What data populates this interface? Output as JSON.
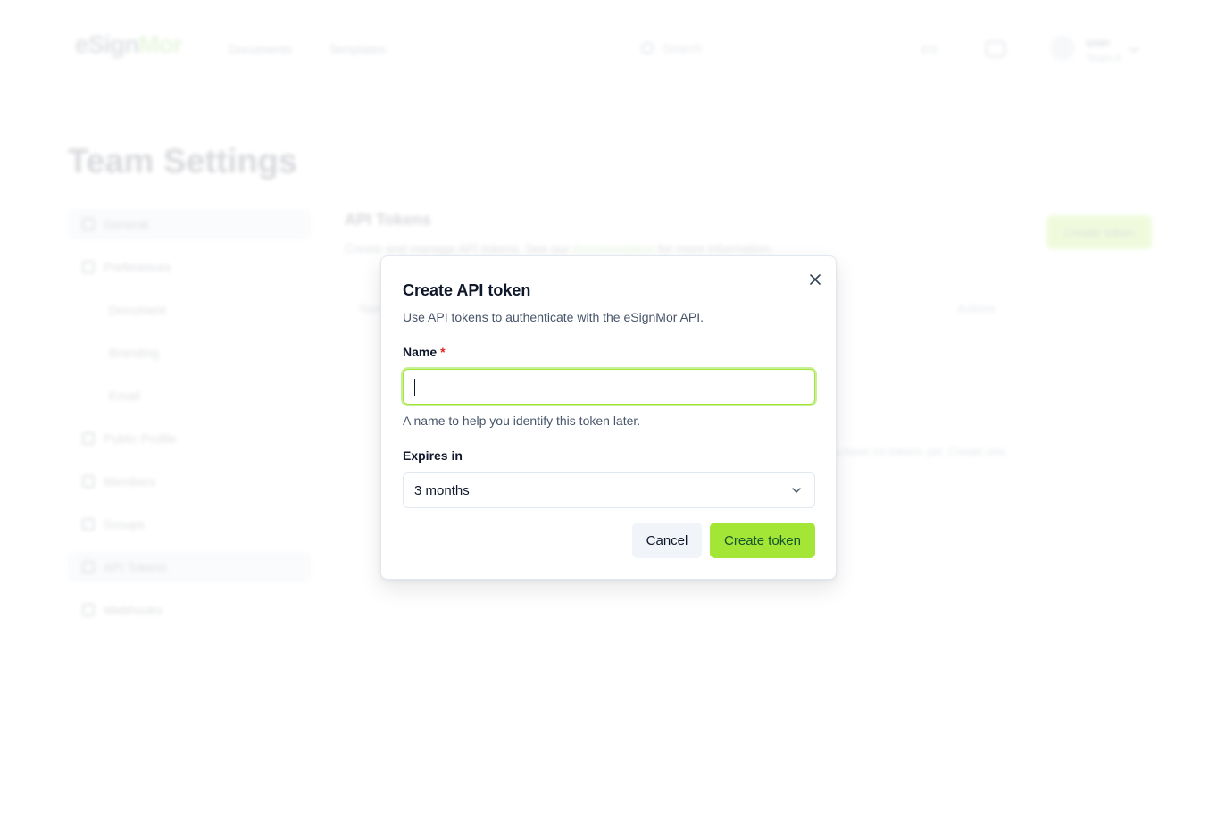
{
  "header": {
    "logo_main": "eSign",
    "logo_accent": "Mor",
    "nav": [
      "Documents",
      "Templates"
    ],
    "search_placeholder": "Search",
    "language": "EN",
    "user_name": "user",
    "user_team": "Team A"
  },
  "page": {
    "title": "Team Settings"
  },
  "sidebar": {
    "items": [
      {
        "label": "General",
        "icon": "settings-icon",
        "active": true
      },
      {
        "label": "Preferences",
        "icon": "brush-icon"
      },
      {
        "label": "Document",
        "sub": true
      },
      {
        "label": "Branding",
        "sub": true
      },
      {
        "label": "Email",
        "sub": true
      },
      {
        "label": "Public Profile",
        "icon": "globe-icon"
      },
      {
        "label": "Members",
        "icon": "users-icon"
      },
      {
        "label": "Groups",
        "icon": "groups-icon"
      },
      {
        "label": "API Tokens",
        "icon": "key-icon",
        "active": true
      },
      {
        "label": "Webhooks",
        "icon": "webhook-icon"
      }
    ]
  },
  "content": {
    "title": "API Tokens",
    "desc_prefix": "Create and manage API tokens. See our ",
    "desc_link": "documentation",
    "desc_suffix": " for more information.",
    "create_button": "Create token",
    "col_name": "Name",
    "col_actions": "Actions",
    "empty": "You have no tokens yet. Create one."
  },
  "modal": {
    "title": "Create API token",
    "description": "Use API tokens to authenticate with the eSignMor API.",
    "name_label": "Name",
    "required_mark": "*",
    "name_value": "",
    "name_help": "A name to help you identify this token later.",
    "expires_label": "Expires in",
    "expires_value": "3 months",
    "cancel": "Cancel",
    "submit": "Create token"
  },
  "colors": {
    "accent": "#a3e635",
    "accent_text": "#14532d",
    "required": "#dc2626"
  }
}
